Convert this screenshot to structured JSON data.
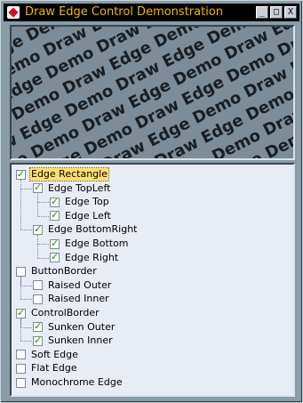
{
  "window": {
    "title": "Draw Edge Control Demonstration",
    "buttons": {
      "minimize": "_",
      "maximize": "□",
      "close": "X"
    }
  },
  "preview": {
    "watermark_text": "Draw Edge Demo"
  },
  "tree": {
    "items": [
      {
        "label": "Edge Rectangle",
        "checked": true,
        "level": 0,
        "selected": true
      },
      {
        "label": "Edge TopLeft",
        "checked": true,
        "level": 1
      },
      {
        "label": "Edge Top",
        "checked": true,
        "level": 2
      },
      {
        "label": "Edge Left",
        "checked": true,
        "level": 2
      },
      {
        "label": "Edge BottomRight",
        "checked": true,
        "level": 1
      },
      {
        "label": "Edge Bottom",
        "checked": true,
        "level": 2
      },
      {
        "label": "Edge Right",
        "checked": true,
        "level": 2
      },
      {
        "label": "ButtonBorder",
        "checked": false,
        "level": 0
      },
      {
        "label": "Raised Outer",
        "checked": false,
        "level": 1
      },
      {
        "label": "Raised Inner",
        "checked": false,
        "level": 1
      },
      {
        "label": "ControlBorder",
        "checked": true,
        "level": 0
      },
      {
        "label": "Sunken Outer",
        "checked": true,
        "level": 1
      },
      {
        "label": "Sunken Inner",
        "checked": true,
        "level": 1
      },
      {
        "label": "Soft Edge",
        "checked": false,
        "level": 0
      },
      {
        "label": "Flat Edge",
        "checked": false,
        "level": 0
      },
      {
        "label": "Monochrome Edge",
        "checked": false,
        "level": 0
      }
    ]
  }
}
